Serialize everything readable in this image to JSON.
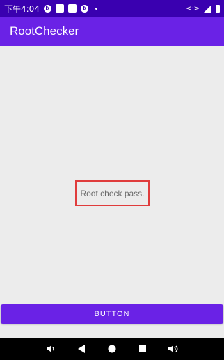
{
  "status_bar": {
    "time": "下午4:04",
    "icons": [
      "data-saver-icon",
      "notification-icon",
      "notification-icon",
      "data-saver-icon",
      "more-dot-icon",
      "sync-icon",
      "signal-icon",
      "battery-icon"
    ]
  },
  "app_bar": {
    "title": "RootChecker",
    "color": "#6a22e6"
  },
  "content": {
    "status_text": "Root check pass.",
    "highlight_color": "#e03c3c"
  },
  "button": {
    "label": "BUTTON"
  },
  "nav_bar": {
    "icons": [
      "volume-down-icon",
      "back-icon",
      "home-icon",
      "recents-icon",
      "volume-up-icon"
    ]
  }
}
